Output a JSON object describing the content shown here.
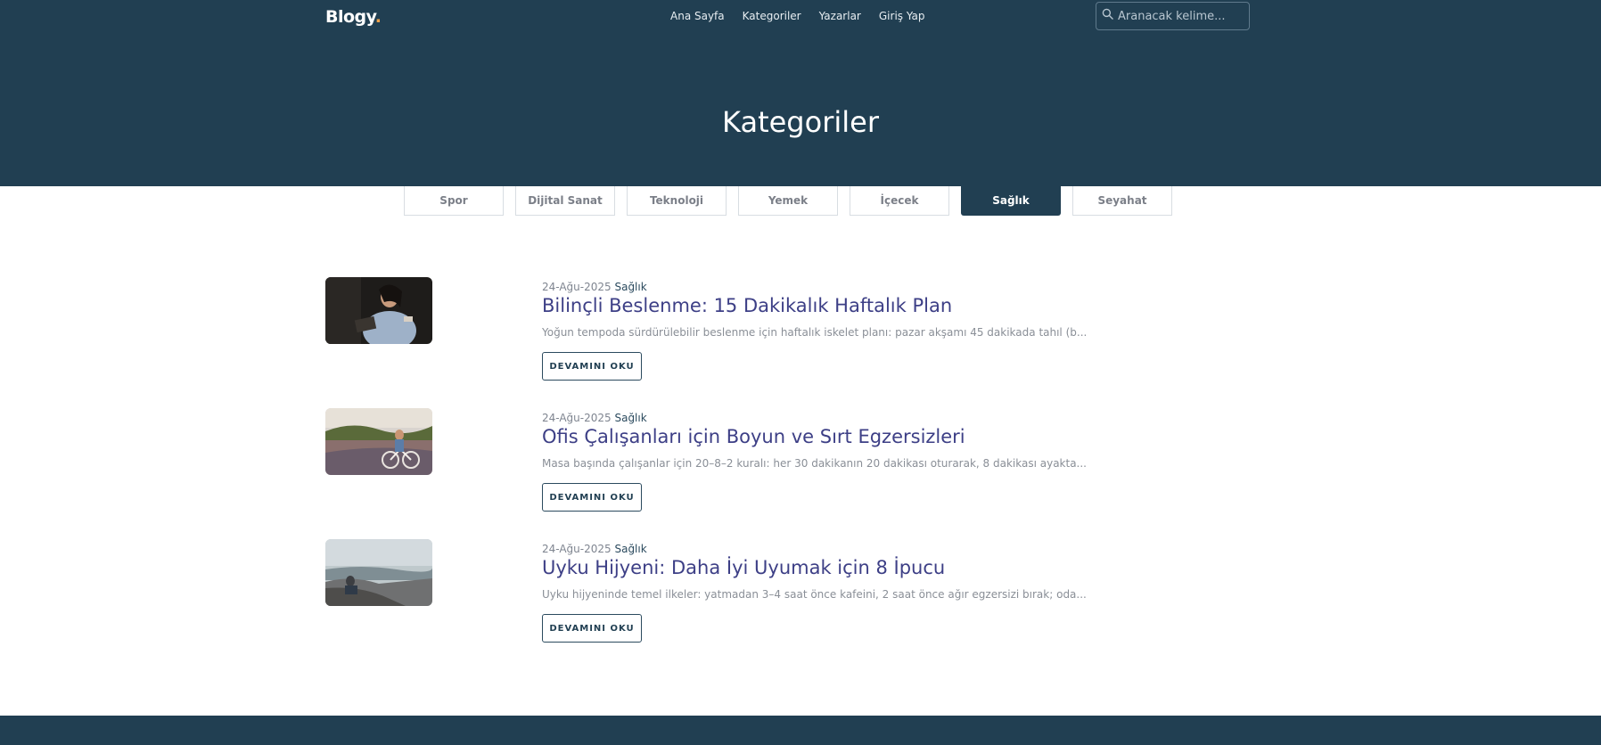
{
  "brand": {
    "logo": "Blogy",
    "logo_dot": "."
  },
  "nav": {
    "items": [
      "Ana Sayfa",
      "Kategoriler",
      "Yazarlar",
      "Giriş Yap"
    ]
  },
  "search": {
    "placeholder": "Aranacak kelime...",
    "icon": "search-icon"
  },
  "page": {
    "title": "Kategoriler"
  },
  "categories": {
    "tabs": [
      "Spor",
      "Dijital Sanat",
      "Teknoloji",
      "Yemek",
      "İçecek",
      "Sağlık",
      "Seyahat"
    ],
    "active": "Sağlık"
  },
  "posts": [
    {
      "date": "24-Ağu-2025",
      "category": "Sağlık",
      "title": "Bilinçli Beslenme: 15 Dakikalık Haftalık Plan",
      "excerpt": "Yoğun tempoda sürdürülebilir beslenme için haftalık iskelet planı: pazar akşamı 45 dakikada tahıl (b...",
      "button": "DEVAMINI OKU"
    },
    {
      "date": "24-Ağu-2025",
      "category": "Sağlık",
      "title": "Ofis Çalışanları için Boyun ve Sırt Egzersizleri",
      "excerpt": "Masa başında çalışanlar için 20–8–2 kuralı: her 30 dakikanın 20 dakikası oturarak, 8 dakikası ayakta...",
      "button": "DEVAMINI OKU"
    },
    {
      "date": "24-Ağu-2025",
      "category": "Sağlık",
      "title": "Uyku Hijyeni: Daha İyi Uyumak için 8 İpucu",
      "excerpt": "Uyku hijyeninde temel ilkeler: yatmadan 3–4 saat önce kafeini, 2 saat önce ağır egzersizi bırak; oda...",
      "button": "DEVAMINI OKU"
    }
  ],
  "colors": {
    "primary": "#213f52",
    "accent": "#f0a24a",
    "title": "#3d3f86"
  }
}
